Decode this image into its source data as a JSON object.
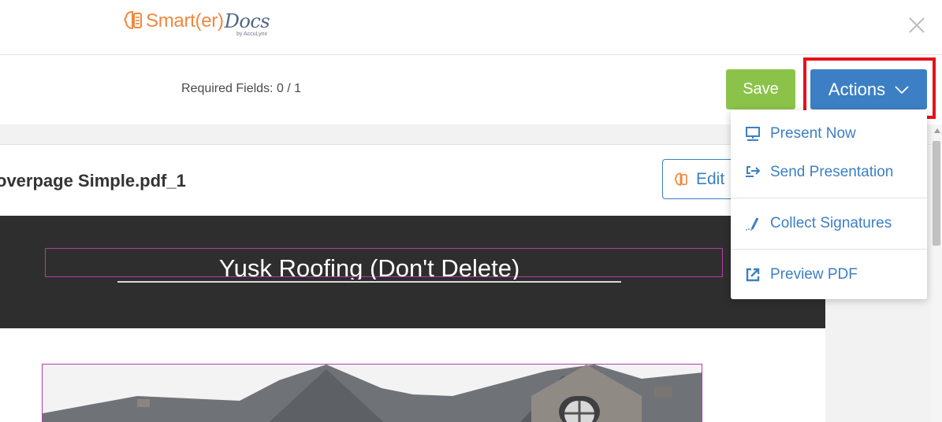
{
  "header": {
    "logo_main": "Smart(er)",
    "logo_docs": "Docs",
    "logo_byline": "by AccuLynx"
  },
  "toolbar": {
    "required_fields": "Required Fields: 0 / 1",
    "save_label": "Save",
    "actions_label": "Actions"
  },
  "document": {
    "filename": "overpage Simple.pdf_1",
    "edit_label": "Edit",
    "title": "Yusk Roofing (Don't Delete)"
  },
  "actions_menu": {
    "items": [
      {
        "label": "Present Now",
        "icon": "presentation-screen-icon"
      },
      {
        "label": "Send Presentation",
        "icon": "send-arrow-icon"
      },
      {
        "label": "Collect Signatures",
        "icon": "signature-pen-icon"
      },
      {
        "label": "Preview PDF",
        "icon": "external-link-icon"
      }
    ]
  },
  "colors": {
    "brand_orange": "#f0883e",
    "brand_navy": "#4f6683",
    "primary_blue": "#3c7fc4",
    "save_green": "#8bc34a",
    "highlight_red": "#e8101c",
    "banner_dark": "#2e2e2e"
  }
}
